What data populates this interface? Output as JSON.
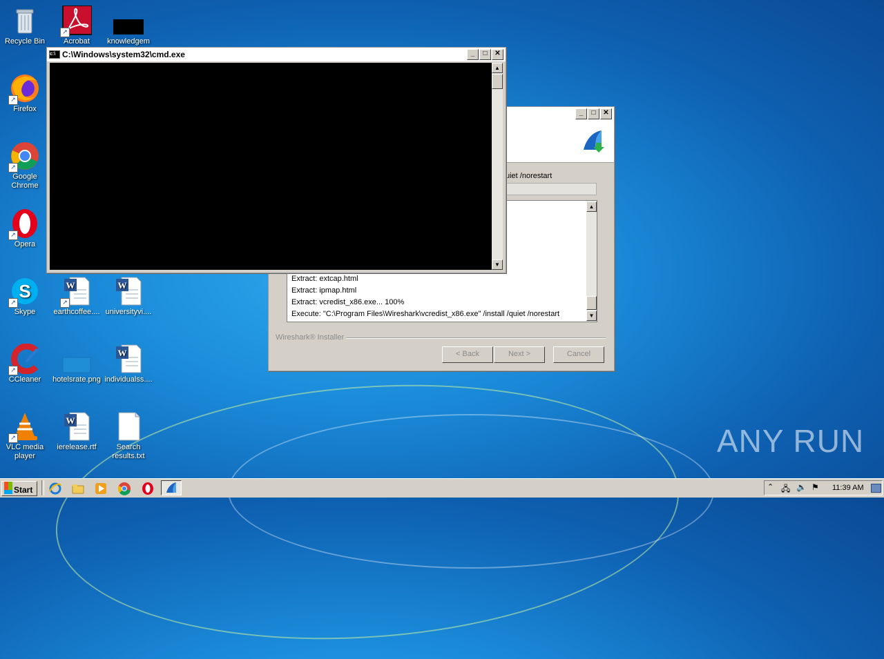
{
  "desktop": {
    "icons": [
      {
        "label": "Recycle Bin",
        "icon": "recycle-bin-icon"
      },
      {
        "label": "Acrobat",
        "icon": "acrobat-icon"
      },
      {
        "label": "knowledgem",
        "icon": "file-icon"
      },
      {
        "label": "Firefox",
        "icon": "firefox-icon"
      },
      {
        "label": "Google Chrome",
        "icon": "chrome-icon"
      },
      {
        "label": "Opera",
        "icon": "opera-icon"
      },
      {
        "label": "Skype",
        "icon": "skype-icon"
      },
      {
        "label": "earthcoffee....",
        "icon": "word-doc-icon"
      },
      {
        "label": "universityvi....",
        "icon": "word-doc-icon"
      },
      {
        "label": "CCleaner",
        "icon": "ccleaner-icon"
      },
      {
        "label": "hotelsrate.png",
        "icon": "image-file-icon"
      },
      {
        "label": "individualss....",
        "icon": "word-doc-icon"
      },
      {
        "label": "VLC media player",
        "icon": "vlc-icon"
      },
      {
        "label": "ierelease.rtf",
        "icon": "word-doc-icon"
      },
      {
        "label": "Search results.txt",
        "icon": "text-file-icon"
      }
    ],
    "watermark": "ANY RUN"
  },
  "cmd_window": {
    "title": "C:\\Windows\\system32\\cmd.exe",
    "minimize": "_",
    "maximize": "□",
    "close": "✕"
  },
  "installer": {
    "status_text": "uiet /norestart",
    "log_lines": [
      "Extract: extcap.html",
      "Extract: ipmap.html",
      "Extract: vcredist_x86.exe... 100%",
      "Execute: \"C:\\Program Files\\Wireshark\\vcredist_x86.exe\" /install /quiet /norestart"
    ],
    "group_label": "Wireshark® Installer",
    "back_label": "< Back",
    "next_label": "Next >",
    "cancel_label": "Cancel",
    "minimize": "_",
    "maximize": "□",
    "close": "✕"
  },
  "taskbar": {
    "start_label": "Start",
    "clock": "11:39 AM",
    "pinned": [
      "ie-icon",
      "explorer-icon",
      "media-player-icon",
      "chrome-icon",
      "opera-icon",
      "wireshark-icon"
    ]
  }
}
